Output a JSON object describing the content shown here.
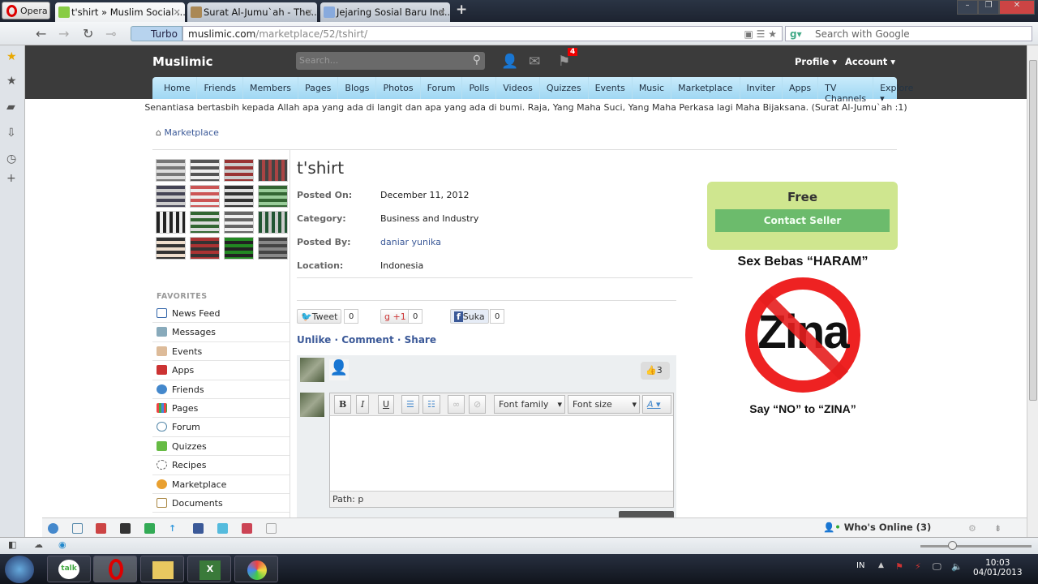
{
  "browser": {
    "menu_label": "Opera",
    "tabs": [
      {
        "title": "t'shirt » Muslim Social ...",
        "active": true
      },
      {
        "title": "Surat Al-Jumu`ah - The..."
      },
      {
        "title": "Jejaring Sosial Baru Ind..."
      }
    ],
    "turbo_label": "Turbo",
    "url_host": "muslimic.com",
    "url_path": "/marketplace/52/tshirt/",
    "search_placeholder": "Search with Google"
  },
  "site": {
    "logo": "Muslimic",
    "search_placeholder": "Search...",
    "notification_count": "4",
    "profile_label": "Profile ▾",
    "account_label": "Account ▾",
    "nav": [
      "Home",
      "Friends",
      "Members",
      "Pages",
      "Blogs",
      "Photos",
      "Forum",
      "Polls",
      "Videos",
      "Quizzes",
      "Events",
      "Music",
      "Marketplace",
      "Inviter",
      "Apps",
      "TV Channels",
      "Explore ▾"
    ],
    "quote": "Senantiasa bertasbih kepada Allah apa yang ada di langit dan apa yang ada di bumi. Raja, Yang Maha Suci, Yang Maha Perkasa lagi Maha Bijaksana. (Surat Al-Jumu`ah :1)"
  },
  "breadcrumb": "Marketplace",
  "favorites": {
    "title": "FAVORITES",
    "items": [
      "News Feed",
      "Messages",
      "Events",
      "Apps",
      "Friends",
      "Pages",
      "Forum",
      "Quizzes",
      "Recipes",
      "Marketplace",
      "Documents"
    ]
  },
  "listing": {
    "title": "t'shirt",
    "fields": [
      {
        "label": "Posted On:",
        "value": "December 11, 2012"
      },
      {
        "label": "Category:",
        "value": "Business and Industry"
      },
      {
        "label": "Posted By:",
        "value": "daniar yunika"
      },
      {
        "label": "Location:",
        "value": "Indonesia"
      }
    ],
    "price": "Free",
    "contact_label": "Contact Seller"
  },
  "social": {
    "tweet": "Tweet",
    "tweet_count": "0",
    "gplus": "+1",
    "gplus_count": "0",
    "fb": "Suka",
    "fb_count": "0"
  },
  "actions": {
    "unlike": "Unlike",
    "comment": "Comment",
    "share": "Share",
    "likes": "3"
  },
  "editor": {
    "bold": "B",
    "italic": "I",
    "underline": "U",
    "font_family": "Font family",
    "font_size": "Font size",
    "path": "Path: p"
  },
  "ad": {
    "top": "Sex Bebas “HARAM”",
    "word": "Zina",
    "bottom": "Say “NO” to “ZINA”"
  },
  "sitebar": {
    "whos_online": "Who's Online (3)"
  },
  "taskbar": {
    "lang": "IN",
    "time": "10:03",
    "date": "04/01/2013"
  }
}
